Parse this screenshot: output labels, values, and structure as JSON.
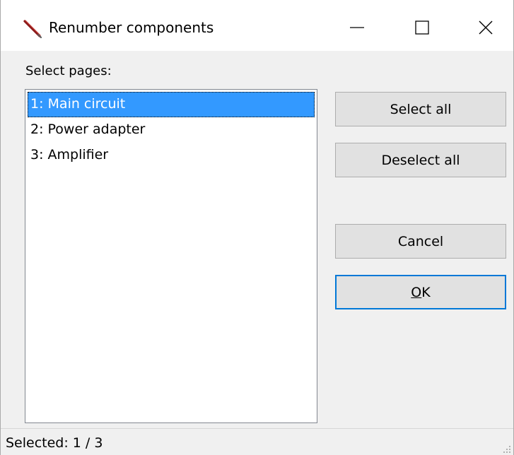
{
  "window": {
    "title": "Renumber components",
    "app_icon": "pencil-icon",
    "controls": {
      "minimize_icon": "minimize-icon",
      "maximize_icon": "maximize-icon",
      "close_icon": "close-icon"
    }
  },
  "pages": {
    "label": "Select pages:",
    "items": [
      {
        "label": "1: Main circuit",
        "selected": true
      },
      {
        "label": "2: Power adapter",
        "selected": false
      },
      {
        "label": "3: Amplifier",
        "selected": false
      }
    ]
  },
  "buttons": {
    "select_all": "Select all",
    "deselect_all": "Deselect all",
    "cancel": "Cancel",
    "ok_mnemonic": "O",
    "ok_rest": "K"
  },
  "status": {
    "text": "Selected: 1 / 3"
  },
  "colors": {
    "selection": "#3399ff",
    "focus_border": "#0078d7",
    "button_face": "#e1e1e1",
    "window_bg": "#f0f0f0"
  }
}
